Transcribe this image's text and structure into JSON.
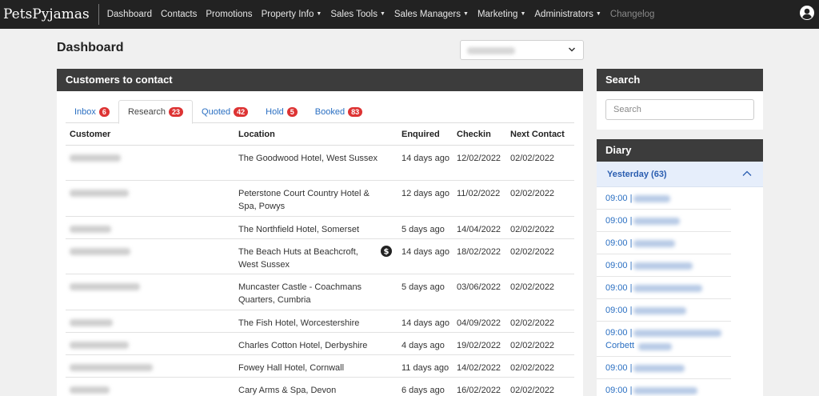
{
  "navbar": {
    "brand": "PetsPyjamas",
    "items": [
      {
        "label": "Dashboard",
        "dropdown": false
      },
      {
        "label": "Contacts",
        "dropdown": false
      },
      {
        "label": "Promotions",
        "dropdown": false
      },
      {
        "label": "Property Info",
        "dropdown": true
      },
      {
        "label": "Sales Tools",
        "dropdown": true
      },
      {
        "label": "Sales Managers",
        "dropdown": true
      },
      {
        "label": "Marketing",
        "dropdown": true
      },
      {
        "label": "Administrators",
        "dropdown": true
      },
      {
        "label": "Changelog",
        "dropdown": false
      }
    ],
    "user_icon": "user-circle-icon"
  },
  "page": {
    "title": "Dashboard"
  },
  "customers_panel": {
    "title": "Customers to contact",
    "tabs": [
      {
        "label": "Inbox",
        "count": "6",
        "active": false
      },
      {
        "label": "Research",
        "count": "23",
        "active": true
      },
      {
        "label": "Quoted",
        "count": "42",
        "active": false
      },
      {
        "label": "Hold",
        "count": "5",
        "active": false
      },
      {
        "label": "Booked",
        "count": "83",
        "active": false
      }
    ],
    "columns": [
      "Customer",
      "Location",
      "Enquired",
      "Checkin",
      "Next Contact"
    ],
    "rows": [
      {
        "location": "The Goodwood Hotel, West Sussex",
        "enquired": "14 days ago",
        "checkin": "12/02/2022",
        "next_contact": "02/02/2022",
        "has_dollar_icon": false
      },
      {
        "location": "Peterstone Court Country Hotel & Spa, Powys",
        "enquired": "12 days ago",
        "checkin": "11/02/2022",
        "next_contact": "02/02/2022",
        "has_dollar_icon": false
      },
      {
        "location": "The Northfield Hotel, Somerset",
        "enquired": "5 days ago",
        "checkin": "14/04/2022",
        "next_contact": "02/02/2022",
        "has_dollar_icon": false
      },
      {
        "location": "The Beach Huts at Beachcroft, West Sussex",
        "enquired": "14 days ago",
        "checkin": "18/02/2022",
        "next_contact": "02/02/2022",
        "has_dollar_icon": true
      },
      {
        "location": "Muncaster Castle - Coachmans Quarters, Cumbria",
        "enquired": "5 days ago",
        "checkin": "03/06/2022",
        "next_contact": "02/02/2022",
        "has_dollar_icon": false
      },
      {
        "location": "The Fish Hotel, Worcestershire",
        "enquired": "14 days ago",
        "checkin": "04/09/2022",
        "next_contact": "02/02/2022",
        "has_dollar_icon": false
      },
      {
        "location": "Charles Cotton Hotel, Derbyshire",
        "enquired": "4 days ago",
        "checkin": "19/02/2022",
        "next_contact": "02/02/2022",
        "has_dollar_icon": false
      },
      {
        "location": "Fowey Hall Hotel, Cornwall",
        "enquired": "11 days ago",
        "checkin": "14/02/2022",
        "next_contact": "02/02/2022",
        "has_dollar_icon": false
      },
      {
        "location": "Cary Arms & Spa, Devon",
        "enquired": "6 days ago",
        "checkin": "16/02/2022",
        "next_contact": "02/02/2022",
        "has_dollar_icon": false
      }
    ]
  },
  "search_panel": {
    "title": "Search",
    "placeholder": "Search"
  },
  "diary_panel": {
    "title": "Diary",
    "section_label": "Yesterday (63)",
    "items": [
      {
        "time": "09:00 |"
      },
      {
        "time": "09:00 |"
      },
      {
        "time": "09:00 |"
      },
      {
        "time": "09:00 |"
      },
      {
        "time": "09:00 |"
      },
      {
        "time": "09:00 |"
      },
      {
        "time": "09:00 |",
        "extra": "Corbett"
      },
      {
        "time": "09:00 |"
      },
      {
        "time": "09:00 |"
      }
    ]
  },
  "colors": {
    "navbar_bg": "#222222",
    "panel_header_bg": "#3c3c3c",
    "link": "#2a6fc2",
    "badge": "#dd3333",
    "diary_highlight": "#e6eefb"
  }
}
